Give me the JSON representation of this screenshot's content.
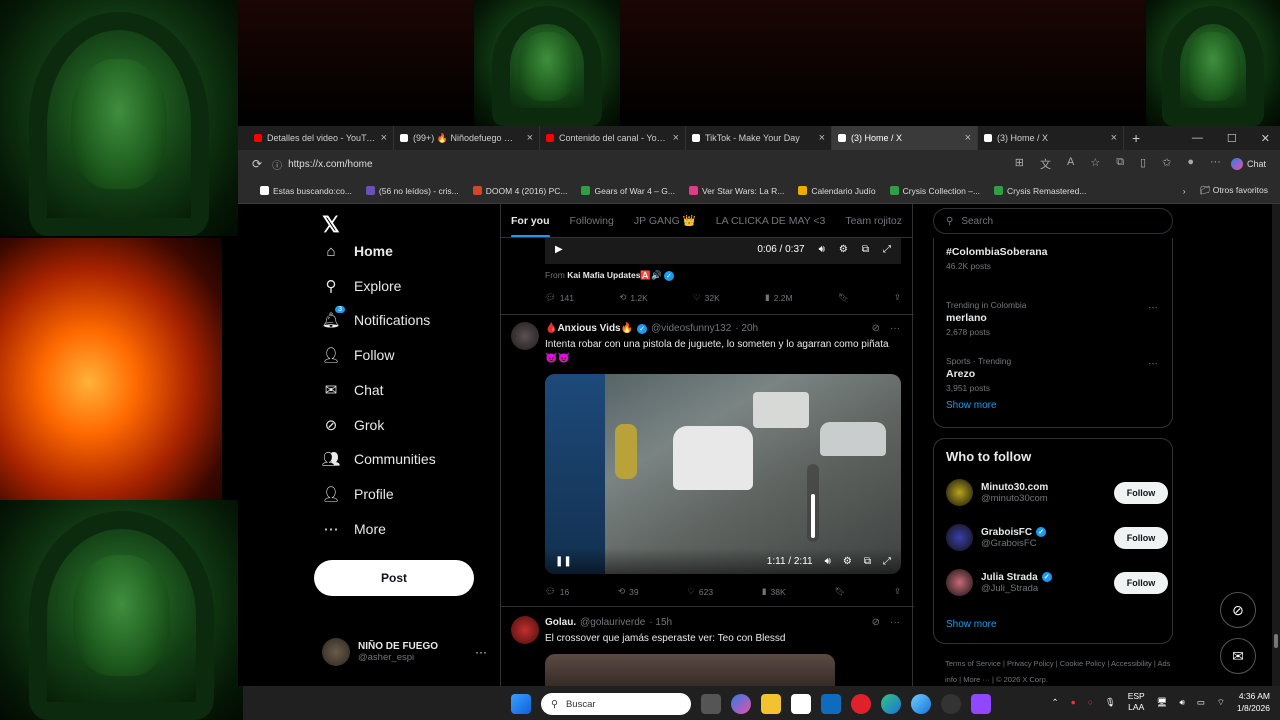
{
  "browser": {
    "tabs": [
      {
        "label": "Detalles del video - YouTube",
        "icon_color": "#ff0000",
        "active": false
      },
      {
        "label": "(99+) 🔥 Niñodefuego 🔥 (@ni",
        "icon_color": "#ffffff",
        "active": false
      },
      {
        "label": "Contenido del canal - YouTube",
        "icon_color": "#ff0000",
        "active": false
      },
      {
        "label": "TikTok - Make Your Day",
        "icon_color": "#ffffff",
        "active": false
      },
      {
        "label": "(3) Home / X",
        "icon_color": "#ffffff",
        "active": true
      },
      {
        "label": "(3) Home / X",
        "icon_color": "#ffffff",
        "active": false
      }
    ],
    "url": "https://x.com/home",
    "chat_label": "Chat",
    "bookmarks": [
      {
        "label": "Estas buscando:co...",
        "color": "#ffffff"
      },
      {
        "label": "(56 no leídos) - cris...",
        "color": "#6b4fbb"
      },
      {
        "label": "DOOM 4 (2016) PC...",
        "color": "#d24726"
      },
      {
        "label": "Gears of War 4 – G...",
        "color": "#2ea043"
      },
      {
        "label": "Ver Star Wars: La R...",
        "color": "#e03c8a"
      },
      {
        "label": "Calendario Judío",
        "color": "#f2a900"
      },
      {
        "label": "Crysis Collection –...",
        "color": "#2ea043"
      },
      {
        "label": "Crysis Remastered...",
        "color": "#2ea043"
      }
    ],
    "other_favorites": "Otros favoritos"
  },
  "nav": {
    "items": [
      {
        "label": "Home",
        "icon": "home-icon",
        "glyph": "⌂",
        "active": true
      },
      {
        "label": "Explore",
        "icon": "search-icon",
        "glyph": "⚲",
        "active": false
      },
      {
        "label": "Notifications",
        "icon": "bell-icon",
        "glyph": "🔔︎",
        "active": false,
        "badge": "3"
      },
      {
        "label": "Follow",
        "icon": "person-plus-icon",
        "glyph": "👤︎",
        "active": false
      },
      {
        "label": "Chat",
        "icon": "envelope-icon",
        "glyph": "✉",
        "active": false
      },
      {
        "label": "Grok",
        "icon": "grok-icon",
        "glyph": "⊘",
        "active": false
      },
      {
        "label": "Communities",
        "icon": "people-icon",
        "glyph": "👥︎",
        "active": false
      },
      {
        "label": "Profile",
        "icon": "profile-icon",
        "glyph": "👤︎",
        "active": false
      },
      {
        "label": "More",
        "icon": "more-circle-icon",
        "glyph": "⋯",
        "active": false
      }
    ],
    "post_label": "Post",
    "profile": {
      "name": "NIÑO DE FUEGO",
      "handle": "@asher_espi"
    }
  },
  "timeline": {
    "tabs": [
      "For you",
      "Following",
      "JP GANG 👑",
      "LA CLICKA DE MAY <3",
      "Team rojitoz"
    ],
    "prev_post": {
      "video_time": "0:06 / 0:37",
      "from_label": "From",
      "from_name": "Kai Mafia Updates🅰️🔊",
      "replies": "141",
      "reposts": "1.2K",
      "likes": "32K",
      "views": "2.2M"
    },
    "post2": {
      "name": "🩸Anxious Vids🔥",
      "handle": "@videosfunny132",
      "time": "· 20h",
      "text": "Intenta robar con una pistola de juguete, lo someten y lo agarran como piñata 😈😈",
      "video_time": "1:11 / 2:11",
      "replies": "16",
      "reposts": "39",
      "likes": "623",
      "views": "38K"
    },
    "post3": {
      "name": "Golau.",
      "handle": "@golauriverde",
      "time": "· 15h",
      "text": "El crossover que jamás esperaste ver: Teo con Blessd"
    }
  },
  "right": {
    "search_placeholder": "Search",
    "trends": [
      {
        "context": "",
        "title": "#ColombiaSoberana",
        "count": "46.2K posts"
      },
      {
        "context": "Trending in Colombia",
        "title": "merlano",
        "count": "2,678 posts"
      },
      {
        "context": "Sports · Trending",
        "title": "Arezo",
        "count": "3,951 posts"
      }
    ],
    "show_more": "Show more",
    "who_to_follow_title": "Who to follow",
    "who_to_follow": [
      {
        "name": "Minuto30.com",
        "handle": "@minuto30com",
        "verified": false,
        "color": "#b8a31a"
      },
      {
        "name": "GraboisFC",
        "handle": "@GraboisFC",
        "verified": true,
        "color": "#3a3fa8"
      },
      {
        "name": "Julia Strada",
        "handle": "@Juli_Strada",
        "verified": true,
        "color": "#c86a78"
      }
    ],
    "follow_label": "Follow",
    "footer": [
      "Terms of Service",
      "Privacy Policy",
      "Cookie Policy",
      "Accessibility",
      "Ads info",
      "More ···",
      "© 2026 X Corp."
    ]
  },
  "taskbar": {
    "search_label": "Buscar",
    "lang_top": "ESP",
    "lang_bottom": "LAA",
    "time": "4:36 AM",
    "date": "1/8/2026"
  }
}
